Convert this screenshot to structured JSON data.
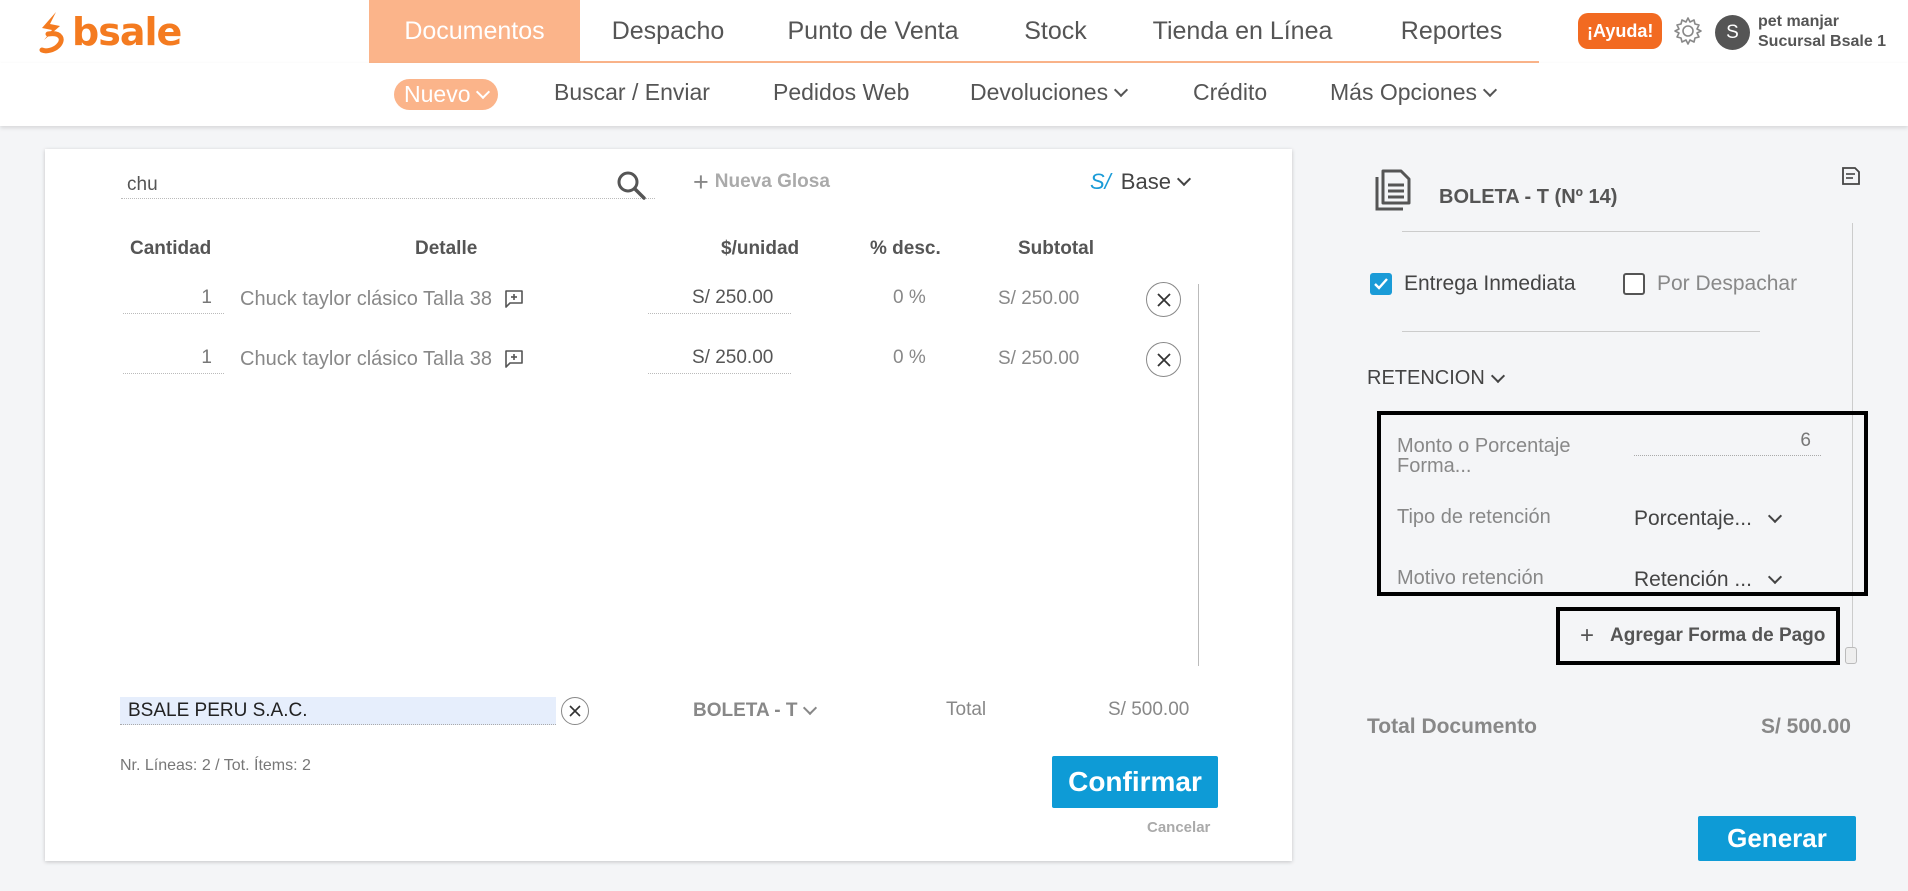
{
  "brand": {
    "name": "bsale",
    "color": "#f47b20"
  },
  "main_nav": {
    "items": [
      {
        "label": "Documentos",
        "active": true
      },
      {
        "label": "Despacho",
        "active": false
      },
      {
        "label": "Punto de Venta",
        "active": false
      },
      {
        "label": "Stock",
        "active": false
      },
      {
        "label": "Tienda en Línea",
        "active": false
      },
      {
        "label": "Reportes",
        "active": false
      }
    ]
  },
  "header": {
    "help_label": "¡Ayuda!",
    "avatar_letter": "S",
    "user_name": "pet manjar",
    "branch": "Sucursal Bsale 1"
  },
  "sub_nav": {
    "items": [
      {
        "label": "Nuevo",
        "dropdown": true,
        "active": true
      },
      {
        "label": "Buscar / Enviar",
        "dropdown": false
      },
      {
        "label": "Pedidos Web",
        "dropdown": false
      },
      {
        "label": "Devoluciones",
        "dropdown": true
      },
      {
        "label": "Crédito",
        "dropdown": false
      },
      {
        "label": "Más Opciones",
        "dropdown": true
      }
    ]
  },
  "editor": {
    "search_value": "chu",
    "nueva_glosa": "Nueva Glosa",
    "currency_symbol": "S/",
    "price_list": "Base",
    "columns": [
      "Cantidad",
      "Detalle",
      "$/unidad",
      "% desc.",
      "Subtotal"
    ],
    "rows": [
      {
        "qty": "1",
        "detail": "Chuck taylor clásico Talla 38",
        "unit_price": "S/ 250.00",
        "discount": "0 %",
        "subtotal": "S/ 250.00"
      },
      {
        "qty": "1",
        "detail": "Chuck taylor clásico Talla 38",
        "unit_price": "S/ 250.00",
        "discount": "0 %",
        "subtotal": "S/ 250.00"
      }
    ],
    "client": "BSALE PERU S.A.C.",
    "doc_type": "BOLETA - T",
    "total_label": "Total",
    "total_value": "S/ 500.00",
    "lines_info": "Nr. Líneas: 2 / Tot. Ítems: 2",
    "confirm_label": "Confirmar",
    "cancel_label": "Cancelar"
  },
  "panel": {
    "doc_title": "BOLETA - T (Nº 14)",
    "entrega_inmediata": {
      "label": "Entrega Inmediata",
      "checked": true
    },
    "por_despachar": {
      "label": "Por Despachar",
      "checked": false
    },
    "retencion_label": "RETENCION",
    "monto_label": "Monto o Porcentaje Forma...",
    "monto_value": "6",
    "tipo_label": "Tipo de retención",
    "tipo_value": "Porcentaje...",
    "motivo_label": "Motivo retención",
    "motivo_value": "Retención ...",
    "add_payment_label": "Agregar Forma de Pago",
    "total_doc_label": "Total Documento",
    "total_doc_value": "S/ 500.00",
    "generate_label": "Generar"
  },
  "colors": {
    "accent_orange": "#fbb48a",
    "help_orange": "#f26a21",
    "primary_blue": "#0e9bd6"
  }
}
